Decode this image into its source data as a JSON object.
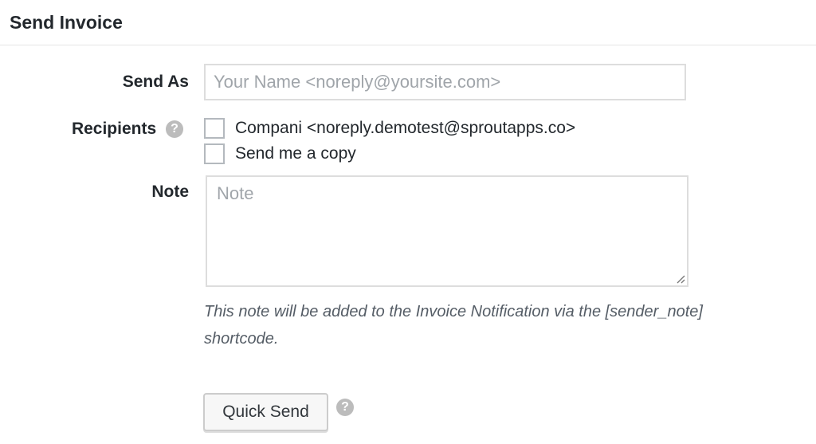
{
  "header": {
    "title": "Send Invoice"
  },
  "form": {
    "send_as": {
      "label": "Send As",
      "placeholder": "Your Name <noreply@yoursite.com>",
      "value": ""
    },
    "recipients": {
      "label": "Recipients",
      "help_glyph": "?",
      "options": [
        {
          "label": "Compani <noreply.demotest@sproutapps.co>",
          "checked": false
        },
        {
          "label": "Send me a copy",
          "checked": false
        }
      ]
    },
    "note": {
      "label": "Note",
      "placeholder": "Note",
      "description": "This note will be added to the Invoice Notification via the [sender_note] shortcode."
    },
    "submit": {
      "label": "Quick Send",
      "help_glyph": "?"
    }
  },
  "icons": {
    "recipients_help": "question-circle-icon",
    "submit_help": "question-circle-icon"
  },
  "colors": {
    "help_icon": "#bcbcbc",
    "field_border": "#dddddd",
    "placeholder": "#a0a5aa"
  }
}
